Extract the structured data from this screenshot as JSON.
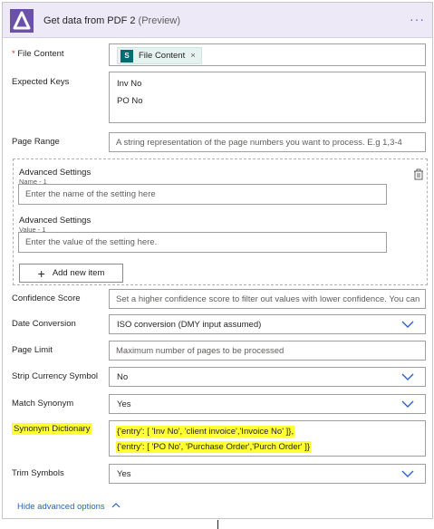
{
  "header": {
    "title": "Get data from PDF 2",
    "preview": "(Preview)",
    "more": "···",
    "accent": "#6b52a8",
    "background": "#ede9f7"
  },
  "fields": {
    "file_content": {
      "label": "File Content",
      "required_mark": "*",
      "token": {
        "icon": "sharepoint-icon",
        "icon_text": "S",
        "text": "File Content",
        "remove": "×"
      }
    },
    "expected_keys": {
      "label": "Expected Keys",
      "lines": [
        "Inv No",
        "PO No"
      ]
    },
    "page_range": {
      "label": "Page Range",
      "placeholder": "A string representation of the page numbers you want to process. E.g 1,3-4"
    },
    "advanced_settings": {
      "name_label": "Advanced Settings",
      "name_ghost": "Name - 1",
      "name_placeholder": "Enter the name of the setting here",
      "value_label": "Advanced Settings",
      "value_ghost": "Value - 1",
      "value_placeholder": "Enter the value of the setting here.",
      "add_button": "Add new item"
    },
    "confidence_score": {
      "label": "Confidence Score",
      "placeholder": "Set a higher confidence score to filter out values with lower confidence. You can"
    },
    "date_conversion": {
      "label": "Date Conversion",
      "value": "ISO conversion (DMY input assumed)"
    },
    "page_limit": {
      "label": "Page Limit",
      "placeholder": "Maximum number of pages to be processed"
    },
    "strip_currency_symbol": {
      "label": "Strip Currency Symbol",
      "value": "No"
    },
    "match_synonym": {
      "label": "Match Synonym",
      "value": "Yes"
    },
    "synonym_dictionary": {
      "label": "Synonym Dictionary",
      "lines": [
        "{'entry': [ 'Inv No', 'client invoice','Invoice No' ]},",
        "{'entry': [ 'PO No', 'Purchase Order','Purch Order' ]}"
      ],
      "highlight_color": "#ffff33"
    },
    "trim_symbols": {
      "label": "Trim Symbols",
      "value": "Yes"
    }
  },
  "footer": {
    "hide_advanced": "Hide advanced options"
  }
}
